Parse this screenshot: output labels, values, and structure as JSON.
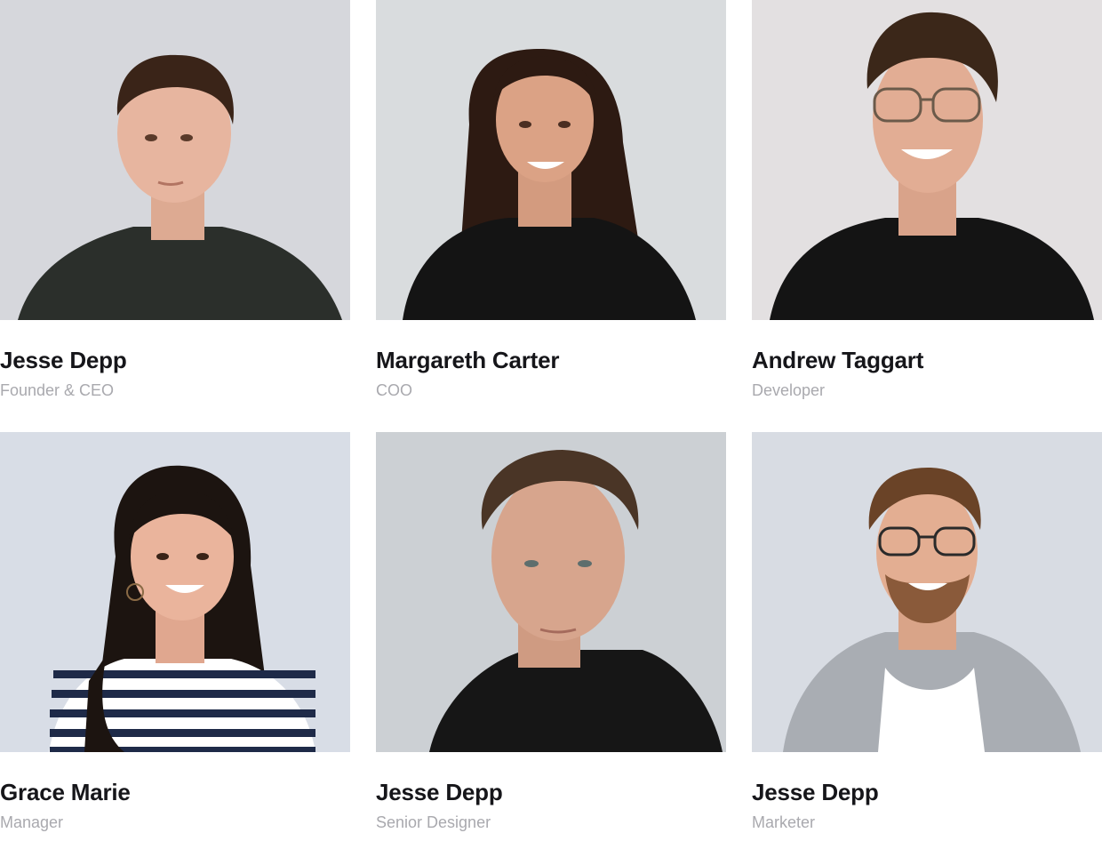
{
  "team": {
    "members": [
      {
        "name": "Jesse Depp",
        "role": "Founder & CEO",
        "photo": "portrait-man-dark-shirt",
        "bg": "#d6d7dc",
        "skin": "#e7b59f",
        "hair": "#3a2418",
        "shirt": "#2b2f2b"
      },
      {
        "name": "Margareth Carter",
        "role": "COO",
        "photo": "portrait-woman-long-hair",
        "bg": "#d9dcde",
        "skin": "#dba285",
        "hair": "#2d1a12",
        "shirt": "#141414"
      },
      {
        "name": "Andrew Taggart",
        "role": "Developer",
        "photo": "portrait-man-glasses",
        "bg": "#e3e0e1",
        "skin": "#e2ad94",
        "hair": "#3b2719",
        "shirt": "#141414"
      },
      {
        "name": "Grace Marie",
        "role": "Manager",
        "photo": "portrait-woman-striped-shirt",
        "bg": "#d8dde6",
        "skin": "#eab49c",
        "hair": "#1c1410",
        "shirt": "#1e2a48"
      },
      {
        "name": "Jesse Depp",
        "role": "Senior Designer",
        "photo": "portrait-man-hoodie",
        "bg": "#ccd0d4",
        "skin": "#d7a58d",
        "hair": "#4a3526",
        "shirt": "#161616"
      },
      {
        "name": "Jesse Depp",
        "role": "Marketer",
        "photo": "portrait-man-blazer",
        "bg": "#d8dce3",
        "skin": "#e3ae92",
        "hair": "#6a4327",
        "shirt": "#a9adb3"
      }
    ]
  }
}
